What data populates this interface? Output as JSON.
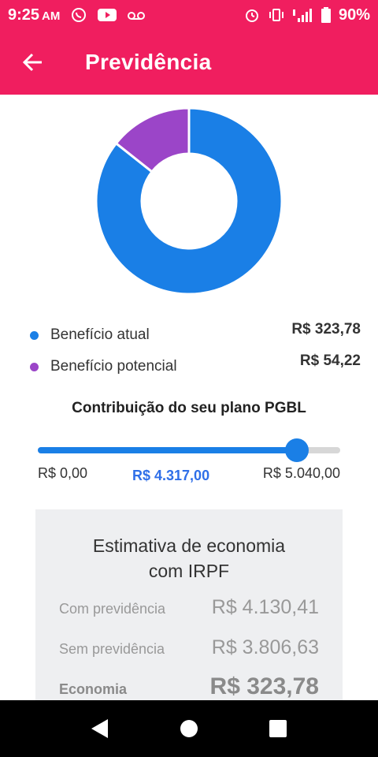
{
  "status_bar": {
    "time": "9:25",
    "ampm": "AM",
    "battery": "90%"
  },
  "app_bar": {
    "title": "Previdência"
  },
  "colors": {
    "brand": "#f01e5f",
    "beneficio_atual": "#1a7fe6",
    "beneficio_potencial": "#9b45c8"
  },
  "chart_data": {
    "type": "pie",
    "style": "donut",
    "labels": [
      "Benefício atual",
      "Benefício potencial"
    ],
    "values": [
      323.78,
      54.22
    ],
    "colors": [
      "#1a7fe6",
      "#9b45c8"
    ]
  },
  "legend": [
    {
      "label": "Benefício atual",
      "value": "R$ 323,78"
    },
    {
      "label": "Benefício potencial",
      "value": "R$ 54,22"
    }
  ],
  "contribution": {
    "title": "Contribuição do seu plano PGBL",
    "min_label": "R$ 0,00",
    "current_label": "R$ 4.317,00",
    "max_label": "R$ 5.040,00",
    "min": 0,
    "max": 5040,
    "value": 4317
  },
  "estimate": {
    "title_line1": "Estimativa de economia",
    "title_line2": "com IRPF",
    "rows": [
      {
        "label": "Com previdência",
        "value": "R$ 4.130,41"
      },
      {
        "label": "Sem previdência",
        "value": "R$ 3.806,63"
      },
      {
        "label": "Economia",
        "value": "R$ 323,78"
      }
    ]
  }
}
